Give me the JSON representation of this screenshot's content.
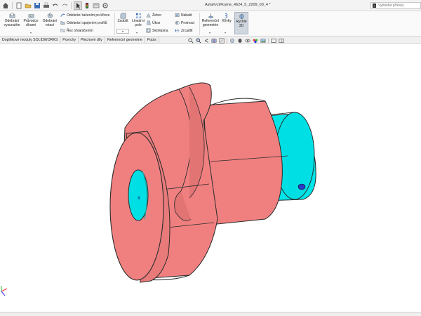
{
  "window": {
    "title": "Asta#vzt#kurne_4624_5_2209_00_4 *",
    "search_placeholder": "Vyhledat příkazy"
  },
  "quick_access": {
    "icons": [
      "home-icon",
      "new-document-icon",
      "open-icon",
      "save-icon",
      "print-icon",
      "undo-icon",
      "redo-icon",
      "select-arrow-icon",
      "rebuild-icon",
      "file-properties-icon",
      "options-icon"
    ]
  },
  "ribbon": {
    "extrude_cut": "Odebrání vysunutím",
    "hole_wizard": "Průvodce dírami",
    "revolve_cut": "Odebrání rotací",
    "swept_cut": "Odebrání tažením po křivce",
    "lofted_cut": "Odebrání spojením profilů",
    "boundary_cut": "Řez ohraničením",
    "fillet": "Zaoblit",
    "linear_pattern": "Lineární pole",
    "rib": "Žebro",
    "draft": "Úkos",
    "shell": "Skořepina",
    "wrap": "Nabalit",
    "intersect": "Protnout",
    "mirror": "Zrcadlit",
    "reference_geometry": "Referenční geometrie",
    "curves": "Křivky",
    "instant3d": "Rychlé 3D"
  },
  "tabs": [
    {
      "label": "Doplňkové moduly SOLIDWORKS"
    },
    {
      "label": "Povrchy"
    },
    {
      "label": "Plechové díly"
    },
    {
      "label": "Referenční geometrie"
    },
    {
      "label": "Popis"
    }
  ],
  "heads_up_toolbar": {
    "icons": [
      "zoom-to-fit-icon",
      "zoom-to-area-icon",
      "previous-view-icon",
      "section-view-icon",
      "dynamic-annotation-icon",
      "view-orientation-icon",
      "display-style-icon",
      "hide-show-icon",
      "edit-appearance-icon",
      "apply-scene-icon",
      "view-settings-icon",
      "display-pane-icon"
    ]
  },
  "colors": {
    "part_body": "#f08080",
    "part_body_dark": "#d26a6a",
    "shaft": "#00e5e8",
    "edges": "#2a2a2a",
    "highlight_button": "#d0d6de"
  }
}
